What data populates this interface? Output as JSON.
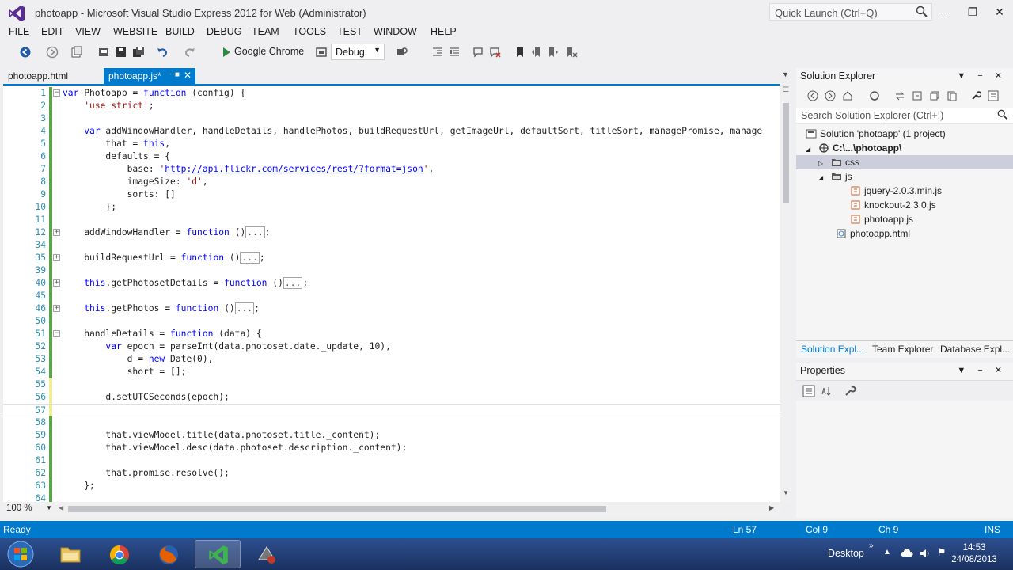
{
  "window": {
    "title": "photoapp - Microsoft Visual Studio Express 2012 for Web (Administrator)",
    "quick_launch_placeholder": "Quick Launch (Ctrl+Q)"
  },
  "menu": [
    "FILE",
    "EDIT",
    "VIEW",
    "WEBSITE",
    "BUILD",
    "DEBUG",
    "TEAM",
    "TOOLS",
    "TEST",
    "WINDOW",
    "HELP"
  ],
  "toolbar": {
    "run_target": "Google Chrome",
    "configuration": "Debug"
  },
  "tabs": {
    "inactive": "photoapp.html",
    "active": "photoapp.js*"
  },
  "editor": {
    "zoom": "100 %",
    "lines": [
      {
        "n": "1",
        "text": "var Photoapp = function (config) {",
        "fold": "minus",
        "chg": "green"
      },
      {
        "n": "2",
        "text": "    'use strict';",
        "chg": "green"
      },
      {
        "n": "3",
        "text": "",
        "chg": "green"
      },
      {
        "n": "4",
        "text": "    var addWindowHandler, handleDetails, handlePhotos, buildRequestUrl, getImageUrl, defaultSort, titleSort, managePromise, manage",
        "chg": "green"
      },
      {
        "n": "5",
        "text": "        that = this,",
        "chg": "green"
      },
      {
        "n": "6",
        "text": "        defaults = {",
        "chg": "green"
      },
      {
        "n": "7",
        "text": "            base: 'http://api.flickr.com/services/rest/?format=json',",
        "chg": "green"
      },
      {
        "n": "8",
        "text": "            imageSize: 'd',",
        "chg": "green"
      },
      {
        "n": "9",
        "text": "            sorts: []",
        "chg": "green"
      },
      {
        "n": "10",
        "text": "        };",
        "chg": "green"
      },
      {
        "n": "11",
        "text": "",
        "chg": "green"
      },
      {
        "n": "12",
        "text": "    addWindowHandler = function ()[...];",
        "fold": "plus",
        "chg": "green"
      },
      {
        "n": "34",
        "text": "",
        "chg": "green"
      },
      {
        "n": "35",
        "text": "    buildRequestUrl = function ()[...];",
        "fold": "plus",
        "chg": "green"
      },
      {
        "n": "39",
        "text": "",
        "chg": "green"
      },
      {
        "n": "40",
        "text": "    this.getPhotosetDetails = function ()[...];",
        "fold": "plus",
        "chg": "green"
      },
      {
        "n": "45",
        "text": "",
        "chg": "green"
      },
      {
        "n": "46",
        "text": "    this.getPhotos = function ()[...];",
        "fold": "plus",
        "chg": "green"
      },
      {
        "n": "50",
        "text": "",
        "chg": "green"
      },
      {
        "n": "51",
        "text": "    handleDetails = function (data) {",
        "fold": "minus",
        "chg": "green"
      },
      {
        "n": "52",
        "text": "        var epoch = parseInt(data.photoset.date._update, 10),",
        "chg": "green"
      },
      {
        "n": "53",
        "text": "            d = new Date(0),",
        "chg": "green"
      },
      {
        "n": "54",
        "text": "            short = [];",
        "chg": "green"
      },
      {
        "n": "55",
        "text": "",
        "chg": "yellow"
      },
      {
        "n": "56",
        "text": "        d.setUTCSeconds(epoch);",
        "chg": "yellow"
      },
      {
        "n": "57",
        "text": "",
        "chg": "yellow"
      },
      {
        "n": "58",
        "text": "",
        "chg": "green"
      },
      {
        "n": "59",
        "text": "        that.viewModel.title(data.photoset.title._content);",
        "chg": "green"
      },
      {
        "n": "60",
        "text": "        that.viewModel.desc(data.photoset.description._content);",
        "chg": "green"
      },
      {
        "n": "61",
        "text": "",
        "chg": "green"
      },
      {
        "n": "62",
        "text": "        that.promise.resolve();",
        "chg": "green"
      },
      {
        "n": "63",
        "text": "    };",
        "chg": "green"
      },
      {
        "n": "64",
        "text": "",
        "chg": "green"
      }
    ]
  },
  "solution_explorer": {
    "title": "Solution Explorer",
    "search_placeholder": "Search Solution Explorer (Ctrl+;)",
    "nodes": [
      {
        "label": "Solution 'photoapp' (1 project)",
        "depth": 0,
        "icon": "solution-icon"
      },
      {
        "label": "C:\\...\\photoapp\\",
        "depth": 1,
        "icon": "website-icon",
        "bold": true
      },
      {
        "label": "css",
        "depth": 2,
        "icon": "folder-icon",
        "selected": true
      },
      {
        "label": "js",
        "depth": 2,
        "icon": "folder-icon"
      },
      {
        "label": "jquery-2.0.3.min.js",
        "depth": 3,
        "icon": "js-file-icon"
      },
      {
        "label": "knockout-2.3.0.js",
        "depth": 3,
        "icon": "js-file-icon"
      },
      {
        "label": "photoapp.js",
        "depth": 3,
        "icon": "js-file-icon"
      },
      {
        "label": "photoapp.html",
        "depth": 2,
        "icon": "html-file-icon"
      }
    ],
    "tabs": [
      "Solution Expl...",
      "Team Explorer",
      "Database Expl..."
    ]
  },
  "properties": {
    "title": "Properties"
  },
  "status": {
    "state": "Ready",
    "ln": "Ln 57",
    "col": "Col 9",
    "ch": "Ch 9",
    "mode": "INS"
  },
  "taskbar": {
    "desktop_label": "Desktop",
    "time": "14:53",
    "date": "24/08/2013"
  },
  "colors": {
    "accent": "#007acc",
    "line_changed_saved": "#57a64a",
    "line_changed_unsaved": "#efef91"
  }
}
